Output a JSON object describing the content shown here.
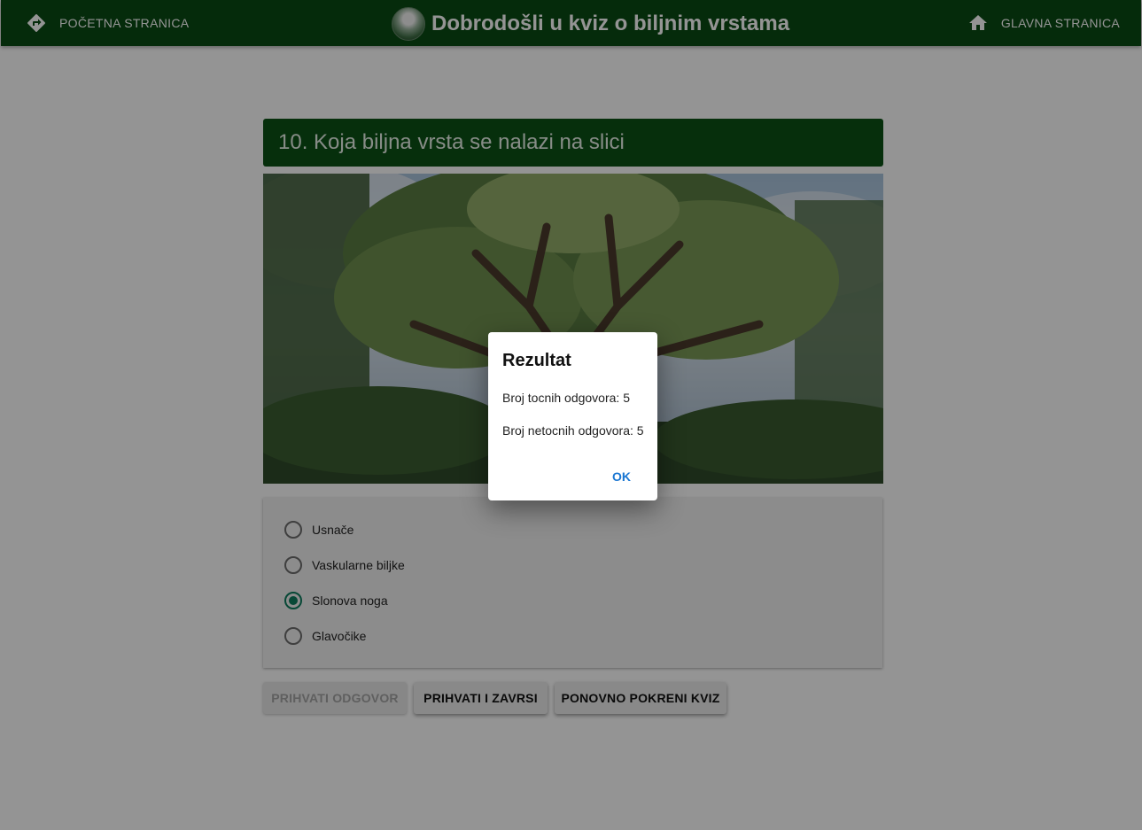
{
  "header": {
    "left_nav": {
      "icon": "directions-icon",
      "label": "POČETNA STRANICA"
    },
    "title": "Dobrodošli u kviz o biljnim vrstama",
    "right_nav": {
      "icon": "home-icon",
      "label": "GLAVNA STRANICA"
    }
  },
  "question": {
    "title": "10. Koja biljna vrsta se nalazi na slici"
  },
  "answers": [
    {
      "label": "Usnače",
      "selected": false
    },
    {
      "label": "Vaskularne biljke",
      "selected": false
    },
    {
      "label": "Slonova noga",
      "selected": true
    },
    {
      "label": "Glavočike",
      "selected": false
    }
  ],
  "buttons": {
    "accept": "PRIHVATI ODGOVOR",
    "accept_finish": "PRIHVATI I ZAVRSI",
    "restart": "PONOVNO POKRENI KVIZ"
  },
  "dialog": {
    "title": "Rezultat",
    "correct_line": "Broj tocnih odgovora: 5",
    "incorrect_line": "Broj netocnih odgovora: 5",
    "ok": "OK"
  }
}
